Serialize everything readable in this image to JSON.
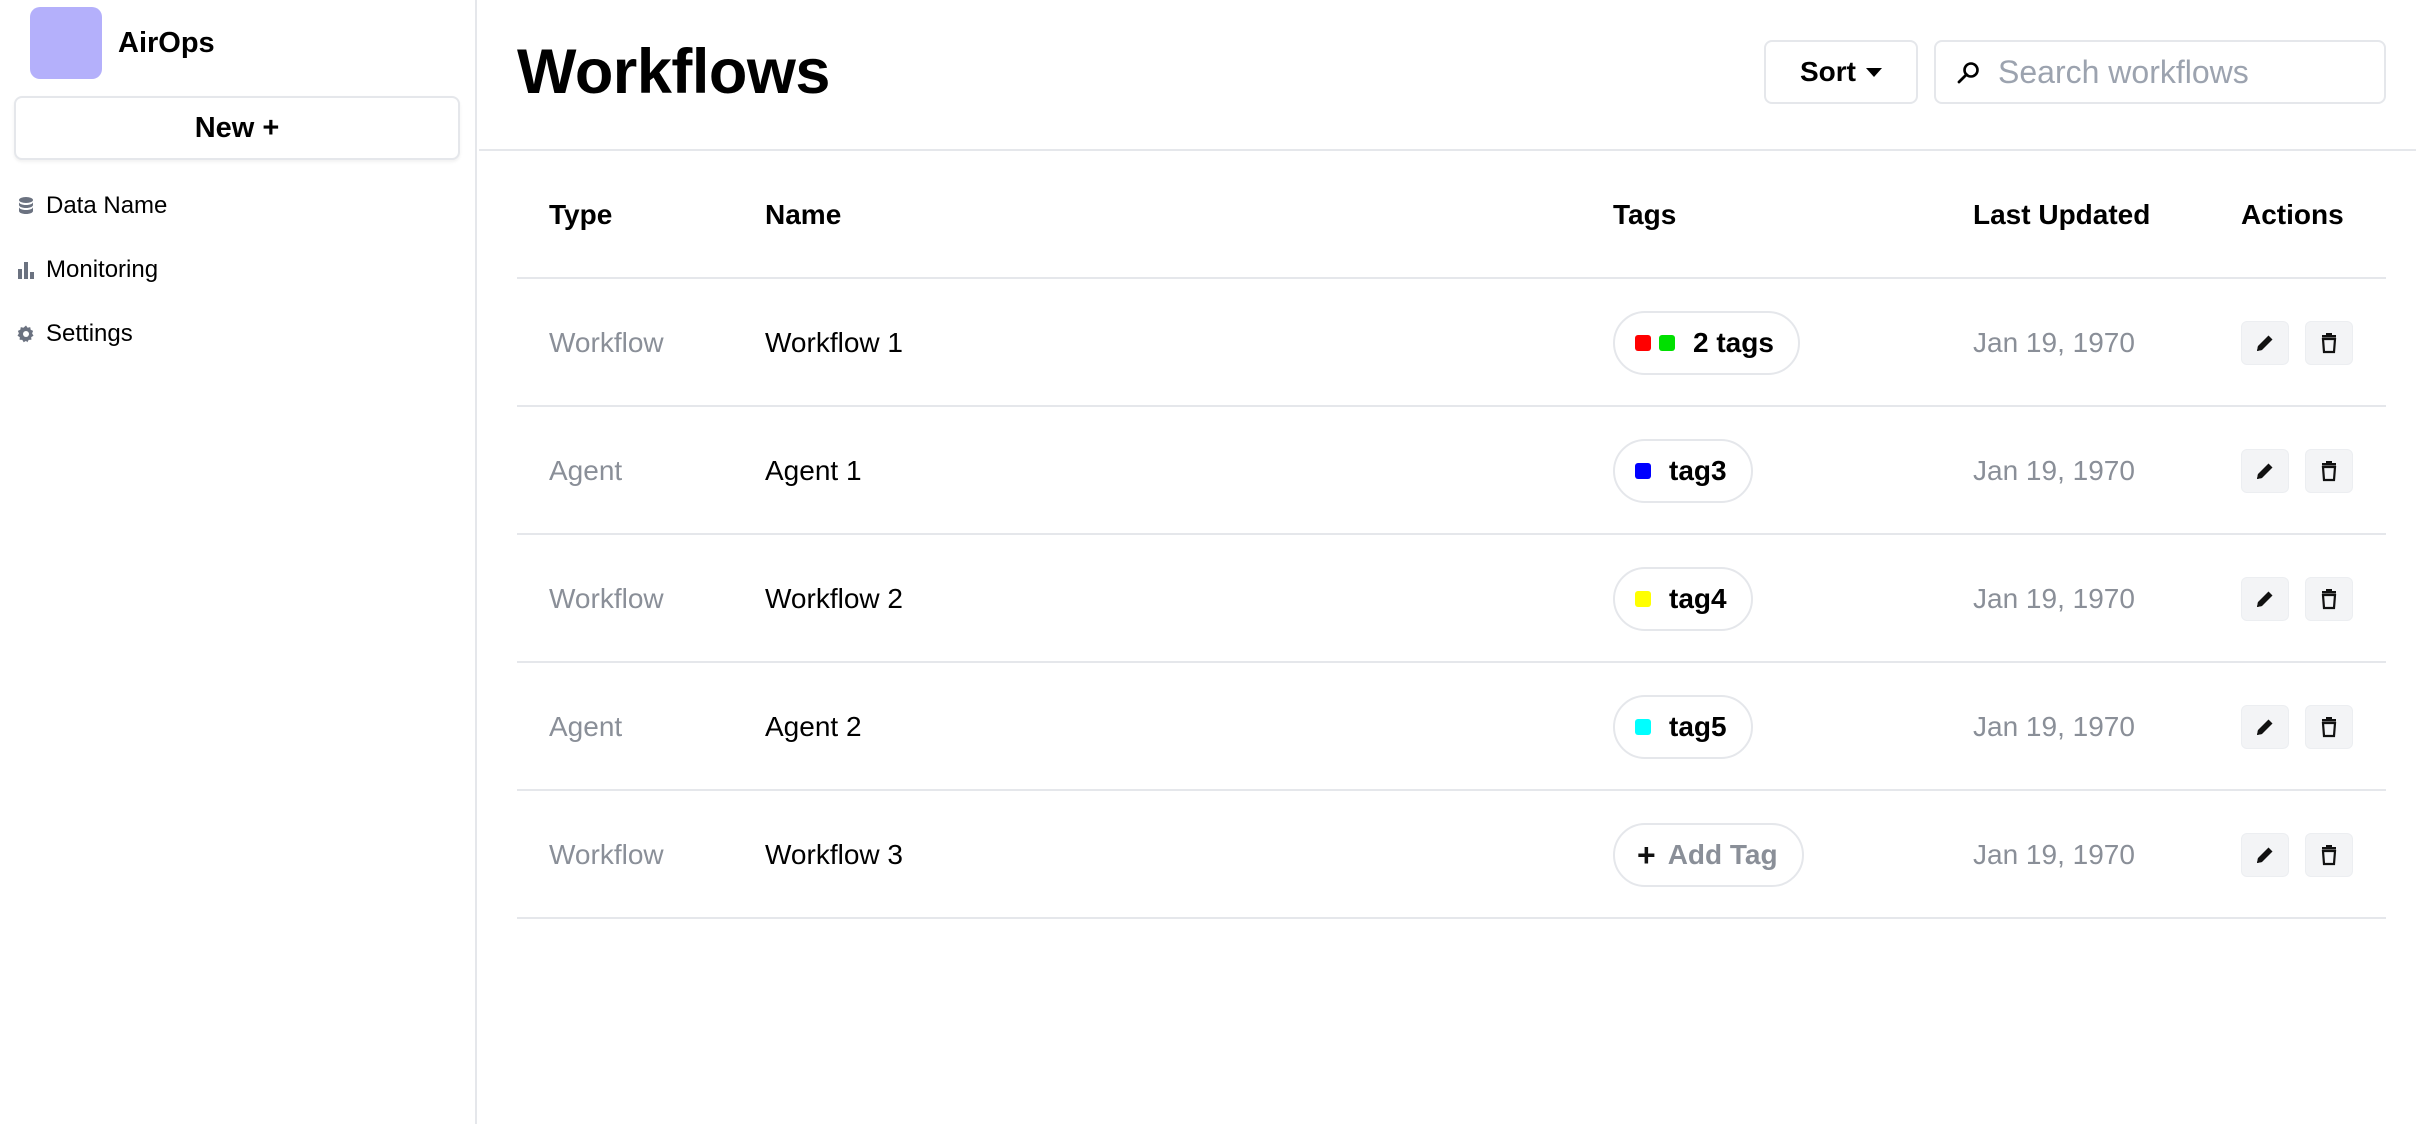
{
  "sidebar": {
    "brand": "AirOps",
    "new_button": "New +",
    "items": [
      {
        "label": "Data Name",
        "icon": "database-icon"
      },
      {
        "label": "Monitoring",
        "icon": "bar-chart-icon"
      },
      {
        "label": "Settings",
        "icon": "gear-icon"
      }
    ]
  },
  "header": {
    "title": "Workflows",
    "sort_label": "Sort",
    "search_placeholder": "Search workflows"
  },
  "table": {
    "columns": [
      "Type",
      "Name",
      "Tags",
      "Last Updated",
      "Actions"
    ],
    "rows": [
      {
        "type": "Workflow",
        "name": "Workflow 1",
        "tags_label": "2 tags",
        "tag_colors": [
          "#ff0000",
          "#00e000"
        ],
        "updated": "Jan 19, 1970"
      },
      {
        "type": "Agent",
        "name": "Agent 1",
        "tags_label": "tag3",
        "tag_colors": [
          "#0000ff"
        ],
        "updated": "Jan 19, 1970"
      },
      {
        "type": "Workflow",
        "name": "Workflow 2",
        "tags_label": "tag4",
        "tag_colors": [
          "#ffff00"
        ],
        "updated": "Jan 19, 1970"
      },
      {
        "type": "Agent",
        "name": "Agent 2",
        "tags_label": "tag5",
        "tag_colors": [
          "#00ffff"
        ],
        "updated": "Jan 19, 1970"
      },
      {
        "type": "Workflow",
        "name": "Workflow 3",
        "add_tag_label": "Add Tag",
        "updated": "Jan 19, 1970"
      }
    ]
  },
  "colors": {
    "logo": "#b4b0fb",
    "muted_text": "#8a8f98",
    "border": "#e5e7eb"
  }
}
